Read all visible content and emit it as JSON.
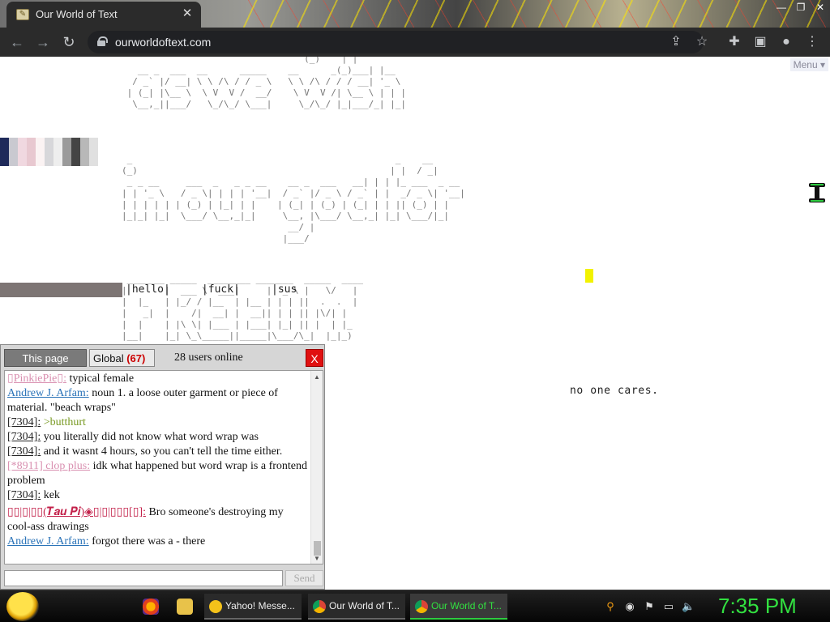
{
  "browser": {
    "tab_title": "Our World of Text",
    "tab_close": "✕",
    "url": "ourworldoftext.com",
    "window_controls": [
      "—",
      "❐",
      "✕"
    ]
  },
  "page": {
    "menu_label": "Menu ▾",
    "ascii_top": "                                  (_)    | |\n   __ _  ___  __      _____    __      _(_)___| |__\n  / _` |/ __| \\ \\ /\\ / / _ \\   \\ \\ /\\ / / / __| '_ \\\n | (_| |\\__ \\  \\ V  V /  __/    \\ V  V /| \\__ \\ | | |\n  \\__,_||___/   \\_/\\_/ \\___|     \\_/\\_/ |_|___/_| |_|",
    "ascii_middle": " _                                                 _    __\n(_)                                               | |  / _|\n _ _ __     ___  _   _ _ __    __ _  ___   __| | | |_ ___  _ __\n| | '_ \\   / _ \\| | | | '__|  / _` |/ _ \\ / _` | |  _/ _ \\| '__|\n| | | | | | (_) | |_| | |    | (_| | (_) | (_| | | || (_) | |\n|_|_| |_|  \\___/ \\__,_|_|     \\__, |\\___/ \\__,_| |_| \\___/|_|\n                               __/ |\n                              |___/",
    "ascii_bottom": " _______ _____  ________ _______  _____  ____\n|       |  ___ \\  ___|     |  _ \\ |   \\/   |\n|  |_   | |_/ / |__  | |__ | | | ||  .  .  |\n|   _|  |    /|  __| |  __|| | | || |\\/| |\n|  |    | |\\ \\| |___ | |___| |_| || |  | |_\n|__|    |_| \\_\\_____||_____|\\___/\\_|  |_|_)",
    "text_row": "|hello|     |fuck|     |sus",
    "no_one_cares": "no one cares."
  },
  "chat": {
    "tab_this_page": "This page",
    "tab_global": "Global",
    "global_count": "(67)",
    "online": "28 users online",
    "close": "X",
    "send": "Send",
    "input_value": "",
    "messages": [
      {
        "nick": "▯PinkiePie▯:",
        "text": " typical female"
      },
      {
        "nick": "Andrew J. Arfam:",
        "text": " noun 1. a loose outer garment or piece of material. \"beach wraps\""
      },
      {
        "nick": "[7304]:",
        "text": " >butthurt"
      },
      {
        "nick": "[7304]:",
        "text": " you literally did not know what word wrap was"
      },
      {
        "nick": "[7304]:",
        "text": " and it wasnt 4 hours, so you can't tell the time either."
      },
      {
        "nick": "[*8911] clop plus:",
        "text": " idk what happened but word wrap is a frontend problem"
      },
      {
        "nick": "[7304]:",
        "text": " kek"
      },
      {
        "nick": "▯▯|▯|▯▯(𝑻𝒂𝒖 𝑷𝒊)◈▯|▯|▯▯▯[▯]:",
        "text": " Bro someone's destroying my cool-ass drawings"
      },
      {
        "nick": "Andrew J. Arfam:",
        "text": " forgot there was a - there"
      }
    ]
  },
  "taskbar": {
    "tasks": [
      "Yahoo! Messe...",
      "Our World of T...",
      "Our World of T..."
    ],
    "clock": "7:35 PM"
  },
  "colors": {
    "chrome_dark": "#2b2b2b",
    "chat_close": "#e01010",
    "clock_green": "#32e040",
    "ascii_gray": "#777777"
  }
}
